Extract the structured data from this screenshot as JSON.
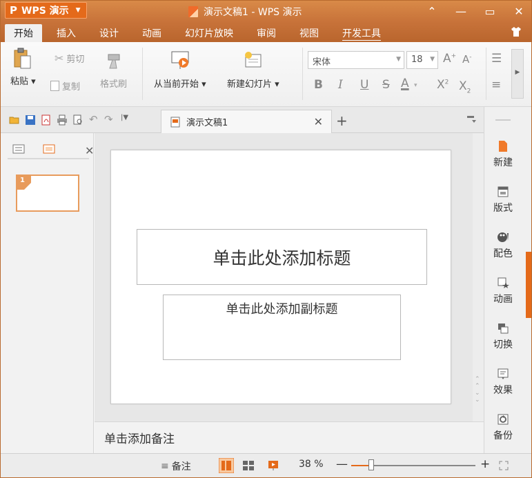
{
  "titlebar": {
    "app_logo": "P",
    "app_name": "WPS 演示",
    "title": "演示文稿1 - WPS 演示"
  },
  "menu": {
    "tabs": [
      {
        "label": "开始",
        "active": true
      },
      {
        "label": "插入"
      },
      {
        "label": "设计"
      },
      {
        "label": "动画"
      },
      {
        "label": "幻灯片放映"
      },
      {
        "label": "审阅"
      },
      {
        "label": "视图"
      },
      {
        "label": "开发工具",
        "underline": true
      }
    ]
  },
  "ribbon": {
    "paste": "粘贴",
    "cut": "剪切",
    "copy": "复制",
    "format_painter": "格式刷",
    "start_from_current": "从当前开始",
    "new_slide": "新建幻灯片",
    "font_name": "宋体",
    "font_size": "18"
  },
  "doc_tab": {
    "name": "演示文稿1"
  },
  "thumbnails": [
    {
      "number": "1"
    }
  ],
  "slide": {
    "title_placeholder": "单击此处添加标题",
    "subtitle_placeholder": "单击此处添加副标题"
  },
  "notes": {
    "placeholder": "单击添加备注"
  },
  "task_pane": {
    "items": [
      "新建",
      "版式",
      "配色",
      "动画",
      "切换",
      "效果",
      "备份"
    ]
  },
  "statusbar": {
    "notes_label": "备注",
    "zoom": "38 %",
    "zoom_fraction": 0.16
  },
  "colors": {
    "accent": "#e46a1a",
    "titlebar": "#c8733a"
  }
}
